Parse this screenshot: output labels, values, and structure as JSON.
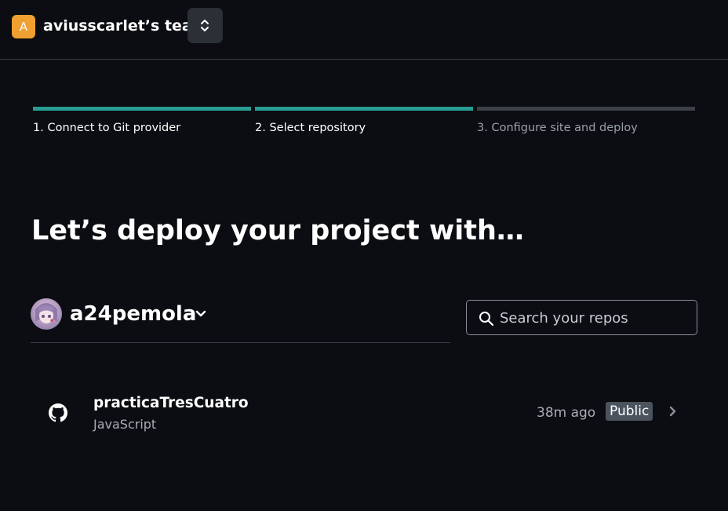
{
  "header": {
    "team_initial": "A",
    "team_name": "aviusscarlet’s team",
    "switcher_icon": "chevron-up-down-icon"
  },
  "steps": [
    {
      "label": "1. Connect to Git provider",
      "status": "complete"
    },
    {
      "label": "2. Select repository",
      "status": "complete"
    },
    {
      "label": "3. Configure site and deploy",
      "status": "pending"
    }
  ],
  "heading": "Let’s deploy your project with…",
  "account": {
    "username": "a24pemola",
    "dropdown_icon": "chevron-down-icon"
  },
  "search": {
    "placeholder": "Search your repos",
    "value": "",
    "icon": "search-icon"
  },
  "repos": [
    {
      "name": "practicaTresCuatro",
      "language": "JavaScript",
      "updated": "38m ago",
      "visibility": "Public",
      "icon": "github-icon"
    }
  ],
  "colors": {
    "background": "#0b0d12",
    "progress_complete": "#2a9d92",
    "progress_pending": "#3c4047",
    "team_avatar": "#f0a030",
    "badge": "#4b535e"
  }
}
